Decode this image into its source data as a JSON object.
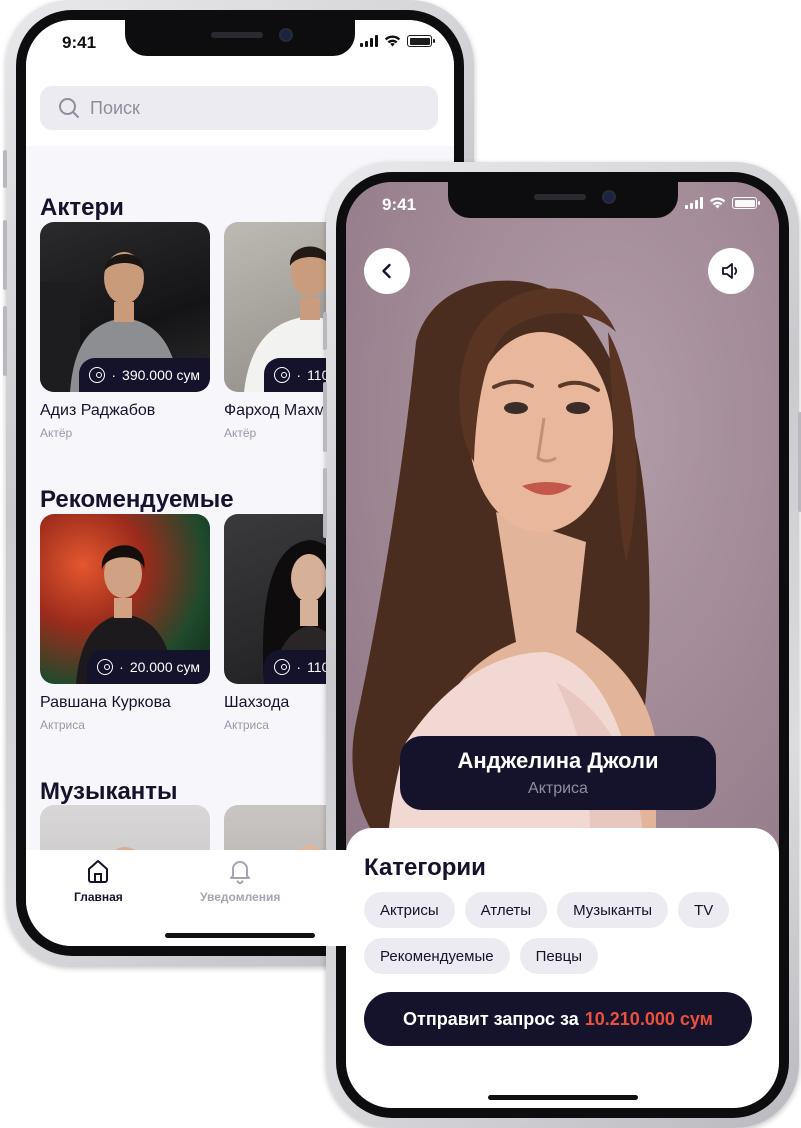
{
  "status": {
    "time": "9:41"
  },
  "left_screen": {
    "search": {
      "placeholder": "Поиск",
      "icon": "search-icon"
    },
    "sections": [
      {
        "title": "Актери",
        "cards": [
          {
            "name": "Адиз Раджабов",
            "role": "Актёр",
            "price": "390.000 сум"
          },
          {
            "name": "Фарход Махмудов",
            "role": "Актёр",
            "price": "110.000 сум"
          }
        ]
      },
      {
        "title": "Рекомендуемые",
        "cards": [
          {
            "name": "Равшана Куркова",
            "role": "Актриса",
            "price": "20.000 сум"
          },
          {
            "name": "Шахзода",
            "role": "Актриса",
            "price": "110.000 сум"
          }
        ]
      },
      {
        "title": "Музыканты",
        "cards": [
          {
            "name": "",
            "role": "",
            "price": ""
          },
          {
            "name": "",
            "role": "",
            "price": ""
          }
        ]
      }
    ],
    "tabs": [
      {
        "label": "Главная",
        "icon": "home-icon",
        "active": true
      },
      {
        "label": "Уведомления",
        "icon": "bell-icon",
        "active": false
      }
    ]
  },
  "right_screen": {
    "back_icon": "chevron-left-icon",
    "sound_icon": "speaker-icon",
    "celebrity": {
      "name": "Анджелина Джоли",
      "role": "Актриса"
    },
    "categories": {
      "title": "Категории",
      "chips": [
        "Актрисы",
        "Атлеты",
        "Музыканты",
        "TV",
        "Рекомендуемые",
        "Певцы"
      ]
    },
    "cta": {
      "label": "Отправит запрос за",
      "price": "10.210.000 сум"
    }
  },
  "colors": {
    "primary": "#15132b",
    "accent_price": "#e9503e",
    "chip_bg": "#ecebf1",
    "hero_bg": "#a58d9b"
  }
}
